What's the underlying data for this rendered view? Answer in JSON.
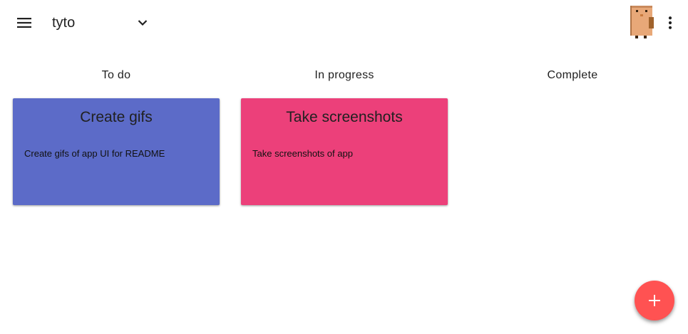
{
  "colors": {
    "todo_card": "#5c6bc8",
    "in_progress_card": "#ec407a",
    "fab": "#ff5252",
    "fab_icon": "#ffffff",
    "text": "#212121"
  },
  "header": {
    "menu_icon": "hamburger-menu-icon",
    "board_title": "tyto",
    "board_select_icon": "chevron-down-icon",
    "avatar_icon": "pixel-owl-avatar",
    "more_icon": "more-vert-icon"
  },
  "columns": [
    {
      "title": "To do",
      "cards": [
        {
          "title": "Create gifs",
          "body": "Create gifs of app UI for README"
        }
      ]
    },
    {
      "title": "In progress",
      "cards": [
        {
          "title": "Take screenshots",
          "body": "Take screenshots of app"
        }
      ]
    },
    {
      "title": "Complete",
      "cards": []
    }
  ],
  "fab": {
    "icon": "plus-icon"
  }
}
